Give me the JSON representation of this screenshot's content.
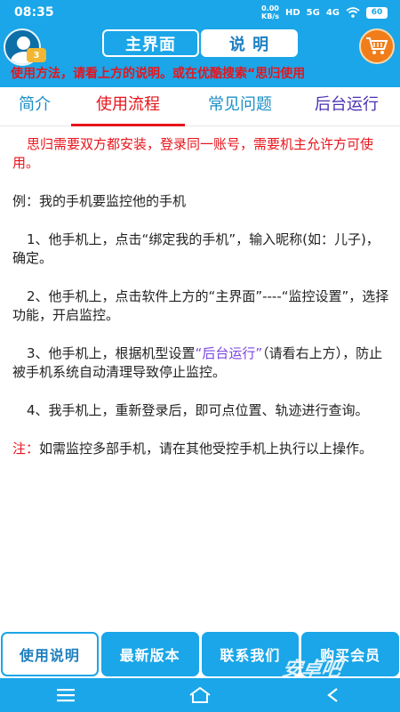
{
  "status_bar": {
    "time": "08:35",
    "net_speed_value": "0.00",
    "net_speed_unit": "KB/s",
    "hd_badge": "HD",
    "sig1": "5G",
    "sig2": "4G",
    "battery": "60"
  },
  "header": {
    "avatar_badge": "3",
    "seg_main": "主界面",
    "seg_help": "说 明",
    "marquee": "使用方法，请看上方的说明。或在优酷搜索“思归使用"
  },
  "tabs": [
    "简介",
    "使用流程",
    "常见问题",
    "后台运行"
  ],
  "content": {
    "intro": "思归需要双方都安装，登录同一账号，需要机主允许方可使用。",
    "example": "例：我的手机要监控他的手机",
    "step1": "1、他手机上，点击“绑定我的手机”，输入昵称(如：儿子)，确定。",
    "step2": "2、他手机上，点击软件上方的“主界面”----“监控设置”，选择功能，开启监控。",
    "step3_pre": "3、他手机上，根据机型设置",
    "step3_highlight": "“后台运行”",
    "step3_post": "（请看右上方），防止被手机系统自动清理导致停止监控。",
    "step4": "4、我手机上，重新登录后，即可点位置、轨迹进行查询。",
    "note_label": "注：",
    "note_text": "如需监控多部手机，请在其他受控手机上执行以上操作。"
  },
  "bottom_buttons": [
    "使用说明",
    "最新版本",
    "联系我们",
    "购买会员"
  ],
  "watermark": "安卓吧",
  "colors": {
    "brand_blue": "#1aa6e8",
    "accent_red": "#e8141c",
    "highlight_purple": "#7a44e0",
    "cart_orange": "#f07d1a"
  }
}
